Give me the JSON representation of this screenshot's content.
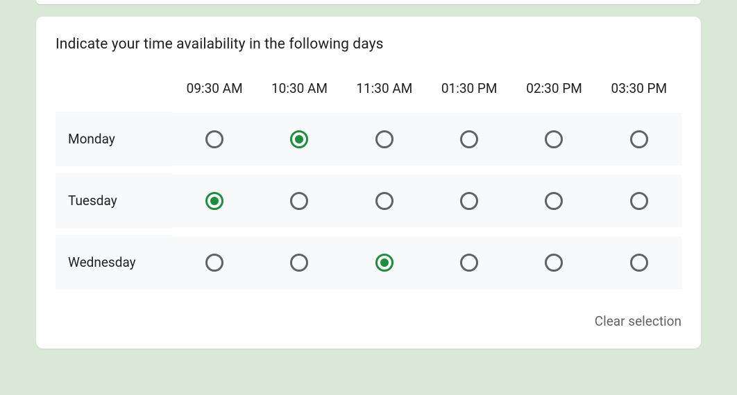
{
  "question": {
    "title": "Indicate your time availability in the following days"
  },
  "columns": [
    "09:30 AM",
    "10:30 AM",
    "11:30 AM",
    "01:30 PM",
    "02:30 PM",
    "03:30 PM"
  ],
  "rows": [
    {
      "label": "Monday",
      "selected_index": 1
    },
    {
      "label": "Tuesday",
      "selected_index": 0
    },
    {
      "label": "Wednesday",
      "selected_index": 2
    }
  ],
  "footer": {
    "clear_label": "Clear selection"
  },
  "colors": {
    "accent": "#1e8e3e",
    "radio_border": "#5f6367",
    "row_bg": "#f8f9fa"
  }
}
